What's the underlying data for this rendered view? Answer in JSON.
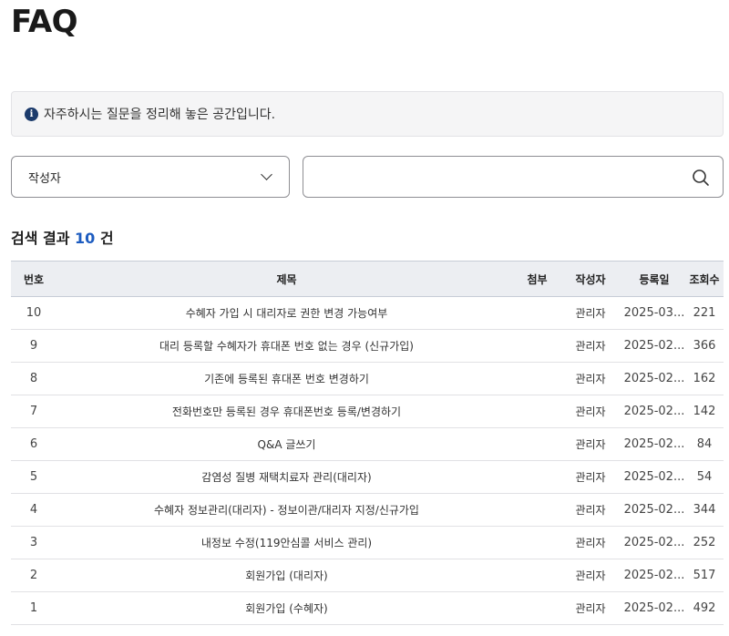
{
  "page": {
    "title": "FAQ"
  },
  "info": {
    "text": "자주하시는 질문을 정리해 놓은 공간입니다."
  },
  "filter": {
    "select_value": "작성자",
    "search_value": ""
  },
  "results": {
    "prefix": "검색 결과 ",
    "count": "10",
    "suffix": " 건"
  },
  "table": {
    "headers": {
      "no": "번호",
      "title": "제목",
      "attach": "첨부",
      "author": "작성자",
      "date": "등록일",
      "views": "조회수"
    },
    "rows": [
      {
        "no": "10",
        "title": "수혜자 가입 시 대리자로 권한 변경 가능여부",
        "attach": "",
        "author": "관리자",
        "date": "2025-03...",
        "views": "221"
      },
      {
        "no": "9",
        "title": "대리 등록할 수혜자가 휴대폰 번호 없는 경우 (신규가입)",
        "attach": "",
        "author": "관리자",
        "date": "2025-02...",
        "views": "366"
      },
      {
        "no": "8",
        "title": "기존에 등록된 휴대폰 번호 변경하기",
        "attach": "",
        "author": "관리자",
        "date": "2025-02...",
        "views": "162"
      },
      {
        "no": "7",
        "title": "전화번호만 등록된 경우 휴대폰번호 등록/변경하기",
        "attach": "",
        "author": "관리자",
        "date": "2025-02...",
        "views": "142"
      },
      {
        "no": "6",
        "title": "Q&A 글쓰기",
        "attach": "",
        "author": "관리자",
        "date": "2025-02...",
        "views": "84"
      },
      {
        "no": "5",
        "title": "감염성 질병 재택치료자 관리(대리자)",
        "attach": "",
        "author": "관리자",
        "date": "2025-02...",
        "views": "54"
      },
      {
        "no": "4",
        "title": "수혜자 정보관리(대리자) - 정보이관/대리자 지정/신규가입",
        "attach": "",
        "author": "관리자",
        "date": "2025-02...",
        "views": "344"
      },
      {
        "no": "3",
        "title": "내정보 수정(119안심콜 서비스 관리)",
        "attach": "",
        "author": "관리자",
        "date": "2025-02...",
        "views": "252"
      },
      {
        "no": "2",
        "title": "회원가입 (대리자)",
        "attach": "",
        "author": "관리자",
        "date": "2025-02...",
        "views": "517"
      },
      {
        "no": "1",
        "title": "회원가입 (수혜자)",
        "attach": "",
        "author": "관리자",
        "date": "2025-02...",
        "views": "492"
      }
    ]
  },
  "colors": {
    "accent": "#1d5cc0",
    "info_icon": "#1b3a6b",
    "header_bg": "#eceef2"
  },
  "icons": {
    "info": "info-circle-icon",
    "dropdown": "chevron-down-icon",
    "search": "search-icon"
  }
}
